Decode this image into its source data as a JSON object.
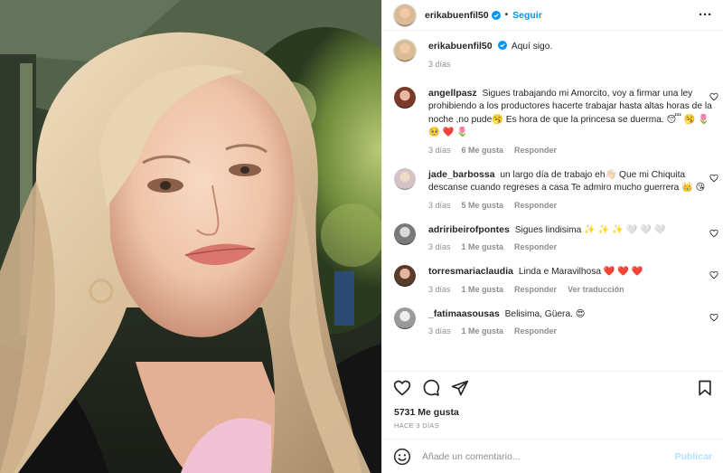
{
  "header": {
    "username": "erikabuenfil50",
    "separator": "•",
    "follow_label": "Seguir",
    "more_label": "···",
    "verified_icon": "verified-badge-icon",
    "verified_color": "#0095f6"
  },
  "caption": {
    "username": "erikabuenfil50",
    "text": "Aquí sigo.",
    "time": "3 días"
  },
  "comments": [
    {
      "username": "angellpasz",
      "text": "Sigues trabajando mi Amorcito, voy a firmar una ley prohibiendo a los productores hacerte trabajar hasta altas horas de la noche ,no pude🥱 Es hora de que la princesa se duerma. 😴 🥱 🌷 🥺 ❤️ 🌷",
      "time": "3 días",
      "likes": "6 Me gusta",
      "reply": "Responder"
    },
    {
      "username": "jade_barbossa",
      "text": "un largo día de trabajo eh👋🏻 Que mi Chiquita descanse cuando regreses a casa Te admiro mucho guerrera 👑 😘",
      "time": "3 días",
      "likes": "5 Me gusta",
      "reply": "Responder"
    },
    {
      "username": "adriribeirofpontes",
      "text": "Sigues lindisima ✨ ✨ ✨ 🤍 🤍 🤍",
      "time": "3 días",
      "likes": "1 Me gusta",
      "reply": "Responder"
    },
    {
      "username": "torresmariaclaudia",
      "text": "Linda e Maravilhosa ❤️ ❤️ ❤️",
      "time": "3 días",
      "likes": "1 Me gusta",
      "reply": "Responder",
      "translate": "Ver traducción"
    },
    {
      "username": "_fatimaasousas",
      "text": "Belisima, Güera. 😍",
      "time": "3 días",
      "likes": "1 Me gusta",
      "reply": "Responder"
    }
  ],
  "actions": {
    "icons": [
      "heart-icon",
      "comment-icon",
      "share-icon",
      "bookmark-icon"
    ]
  },
  "likes_count": "5731 Me gusta",
  "posted_ago": "HACE 3 DÍAS",
  "comment_box": {
    "placeholder": "Añade un comentario...",
    "publish_label": "Publicar",
    "publish_color": "#b2dffc"
  },
  "colors": {
    "accent": "#0095f6",
    "muted_text": "#8e8e8e",
    "border": "#efefef"
  }
}
